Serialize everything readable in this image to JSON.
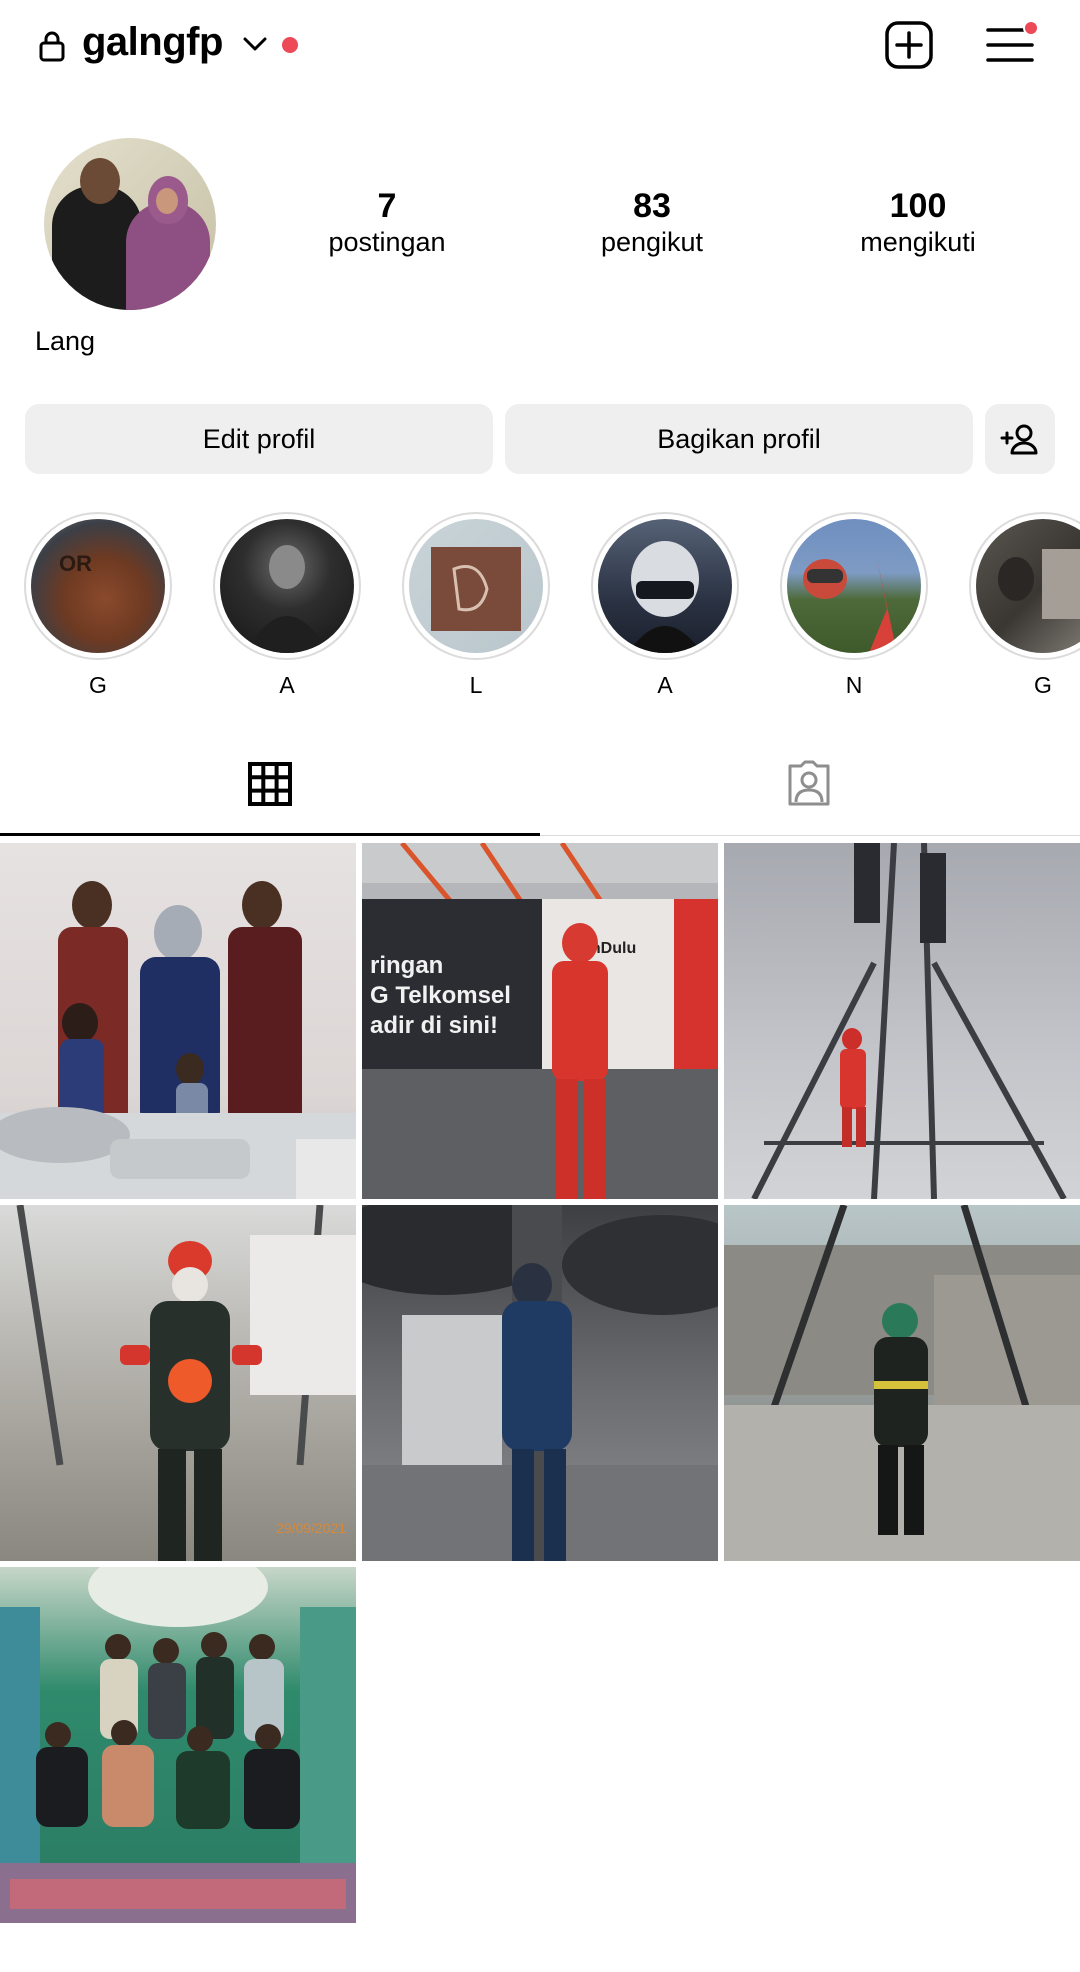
{
  "header": {
    "username": "galngfp",
    "icons": [
      "lock-icon",
      "chevron-down-icon",
      "add-post-icon",
      "menu-icon"
    ],
    "notification_color": "#ed4956"
  },
  "profile": {
    "display_name": "Lang",
    "stats": {
      "posts_count": "7",
      "posts_label": "postingan",
      "followers_count": "83",
      "followers_label": "pengikut",
      "following_count": "100",
      "following_label": "mengikuti"
    }
  },
  "actions": {
    "edit_label": "Edit profil",
    "share_label": "Bagikan profil"
  },
  "highlights": [
    {
      "label": "G"
    },
    {
      "label": "A"
    },
    {
      "label": "L"
    },
    {
      "label": "A"
    },
    {
      "label": "N"
    },
    {
      "label": "G"
    }
  ],
  "tabs": {
    "active": "grid",
    "items": [
      "grid-icon",
      "tagged-icon"
    ]
  },
  "posts_count_visible": 7,
  "post_images": [
    {
      "text": "",
      "desc": "family photo"
    },
    {
      "text": "ringan / G Telkomsel / adir di sini! / GinDulu",
      "desc": "worker in red suit"
    },
    {
      "text": "",
      "desc": "tower climber"
    },
    {
      "text": "29/09/2021",
      "desc": "worker with harness"
    },
    {
      "text": "",
      "desc": "worker at cabinet"
    },
    {
      "text": "",
      "desc": "rooftop worker"
    },
    {
      "text": "",
      "desc": "group photo"
    }
  ]
}
